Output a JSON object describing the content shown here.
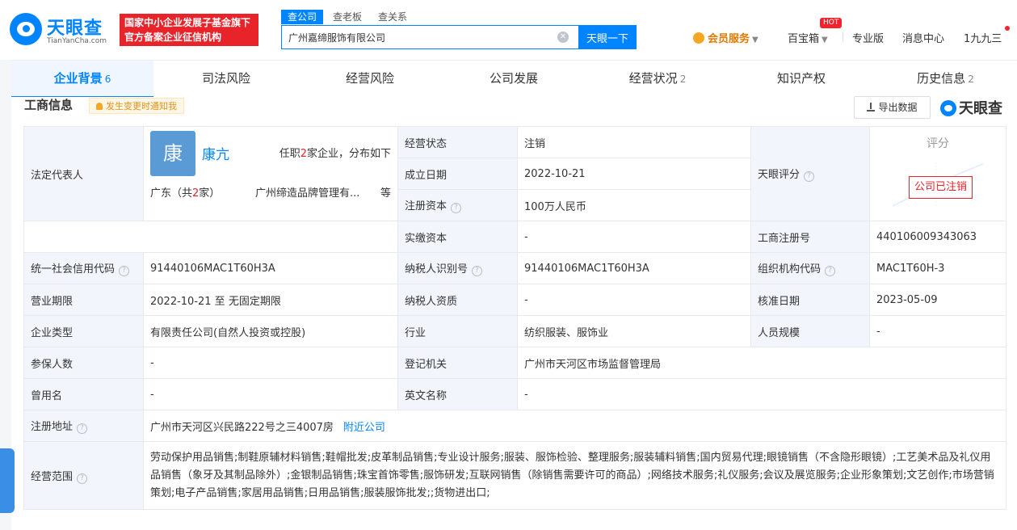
{
  "header": {
    "logo_cn": "天眼查",
    "logo_en": "TianYanCha.com",
    "gov_line1": "国家中小企业发展子基金旗下",
    "gov_line2": "官方备案企业征信机构",
    "search_tabs": [
      "查公司",
      "查老板",
      "查关系"
    ],
    "search_value": "广州嘉缔服饰有限公司",
    "search_button": "天眼一下",
    "vip": "会员服务",
    "baibaoxiang": "百宝箱",
    "hot": "HOT",
    "pro": "专业版",
    "messages": "消息中心",
    "user": "1九九三"
  },
  "tabs": [
    {
      "label": "企业背景",
      "count": "6"
    },
    {
      "label": "司法风险",
      "count": ""
    },
    {
      "label": "经营风险",
      "count": ""
    },
    {
      "label": "公司发展",
      "count": ""
    },
    {
      "label": "经营状况",
      "count": "2"
    },
    {
      "label": "知识产权",
      "count": ""
    },
    {
      "label": "历史信息",
      "count": "2"
    }
  ],
  "section": {
    "title": "工商信息",
    "notify": "发生变更时通知我",
    "export": "导出数据",
    "watermark": "天眼查"
  },
  "info": {
    "legal_rep_label": "法定代表人",
    "rep_avatar": "康",
    "rep_name": "康亢",
    "rep_role_prefix": "任职",
    "rep_role_count": "2",
    "rep_role_suffix": "家企业，分布如下",
    "rep_region_prefix": "广东（共",
    "rep_region_count": "2",
    "rep_region_suffix": "家）",
    "rep_company": "广州缔造品牌管理有...",
    "rep_more": "等",
    "status_label": "经营状态",
    "status": "注销",
    "found_label": "成立日期",
    "found": "2022-10-21",
    "capital_label": "注册资本",
    "capital": "100万人民币",
    "paid_label": "实缴资本",
    "paid": "-",
    "score_label": "天眼评分",
    "score_title": "评分",
    "score_stamp": "公司已注销",
    "reg_no_label": "工商注册号",
    "reg_no": "440106009343063",
    "credit_label": "统一社会信用代码",
    "credit": "91440106MAC1T60H3A",
    "tax_label": "纳税人识别号",
    "tax": "91440106MAC1T60H3A",
    "org_label": "组织机构代码",
    "org": "MAC1T60H-3",
    "term_label": "营业期限",
    "term": "2022-10-21 至 无固定期限",
    "taxq_label": "纳税人资质",
    "taxq": "-",
    "approve_label": "核准日期",
    "approve": "2023-05-09",
    "type_label": "企业类型",
    "type": "有限责任公司(自然人投资或控股)",
    "industry_label": "行业",
    "industry": "纺织服装、服饰业",
    "staff_label": "人员规模",
    "staff": "-",
    "insured_label": "参保人数",
    "insured": "-",
    "authority_label": "登记机关",
    "authority": "广州市天河区市场监督管理局",
    "former_label": "曾用名",
    "former": "-",
    "en_label": "英文名称",
    "en": "-",
    "addr_label": "注册地址",
    "addr": "广州市天河区兴民路222号之三4007房",
    "addr_link": "附近公司",
    "scope_label": "经营范围",
    "scope": "劳动保护用品销售;制鞋原辅材料销售;鞋帽批发;皮革制品销售;专业设计服务;服装、服饰检验、整理服务;服装辅料销售;国内贸易代理;眼镜销售（不含隐形眼镜）;工艺美术品及礼仪用品销售（象牙及其制品除外）;金银制品销售;珠宝首饰零售;服饰研发;互联网销售（除销售需要许可的商品）;网络技术服务;礼仪服务;会议及展览服务;企业形象策划;文艺创作;市场营销策划;电子产品销售;家居用品销售;日用品销售;服装服饰批发;;货物进出口;"
  }
}
